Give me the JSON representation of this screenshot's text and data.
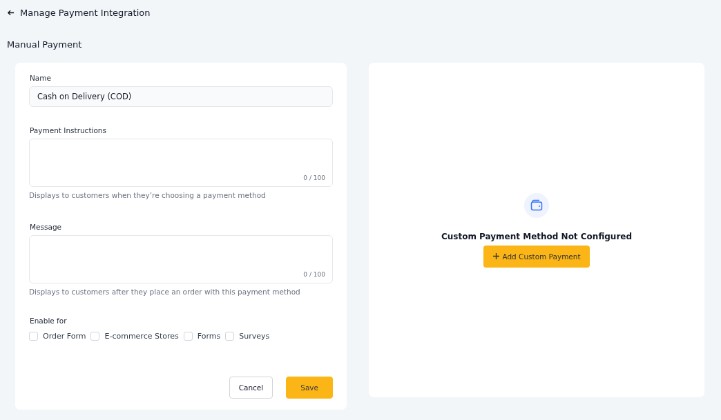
{
  "header": {
    "title": "Manage Payment Integration"
  },
  "section_title": "Manual Payment",
  "form": {
    "name": {
      "label": "Name",
      "value": "Cash on Delivery (COD)"
    },
    "textareas": [
      {
        "label": "Payment Instructions",
        "counter": "0 / 100",
        "help": "Displays to customers when they’re choosing a payment method"
      },
      {
        "label": "Message",
        "counter": "0 / 100",
        "help": "Displays to customers after they place an order with this payment method"
      }
    ],
    "enable_for": {
      "label": "Enable for",
      "options": [
        {
          "label": "Order Form",
          "checked": false
        },
        {
          "label": "E-commerce Stores",
          "checked": false
        },
        {
          "label": "Forms",
          "checked": false
        },
        {
          "label": "Surveys",
          "checked": false
        }
      ]
    },
    "buttons": [
      {
        "label": "Cancel",
        "kind": "secondary"
      },
      {
        "label": "Save",
        "kind": "primary"
      }
    ]
  },
  "empty_state": {
    "title": "Custom Payment Method Not Configured",
    "button": "Add Custom Payment"
  }
}
